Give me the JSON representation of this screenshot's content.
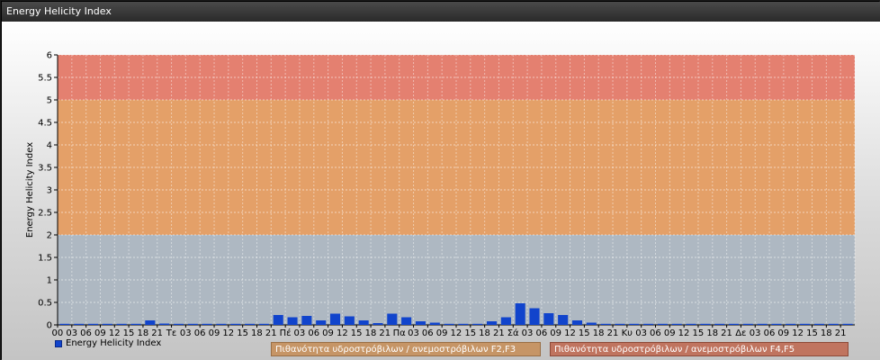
{
  "window": {
    "title": "Energy Helicity Index"
  },
  "colors": {
    "bar": "#1144cc",
    "band_low": "#aeb8c2",
    "band_mid": "#e4a068",
    "band_high": "#e48070"
  },
  "chart_data": {
    "type": "bar",
    "title": "",
    "xlabel": "",
    "ylabel": "Energy Helicity Index",
    "ylim": [
      0,
      6
    ],
    "yticks": [
      "0",
      "0.5",
      "1",
      "1.5",
      "2",
      "2.5",
      "3",
      "3.5",
      "4",
      "4.5",
      "5",
      "5.5",
      "6"
    ],
    "grid": true,
    "categories": [
      "00",
      "03",
      "06",
      "09",
      "12",
      "15",
      "18",
      "21",
      "Τε",
      "03",
      "06",
      "09",
      "12",
      "15",
      "18",
      "21",
      "Πέ",
      "03",
      "06",
      "09",
      "12",
      "15",
      "18",
      "21",
      "Πα",
      "03",
      "06",
      "09",
      "12",
      "15",
      "18",
      "21",
      "Σά",
      "03",
      "06",
      "09",
      "12",
      "15",
      "18",
      "21",
      "Κυ",
      "03",
      "06",
      "09",
      "12",
      "15",
      "18",
      "21",
      "Δε",
      "03",
      "06",
      "09",
      "12",
      "15",
      "18",
      "21"
    ],
    "series": [
      {
        "name": "Energy Helicity Index",
        "values": [
          0,
          0,
          0,
          0,
          0,
          0,
          0.1,
          0.03,
          0,
          0,
          0,
          0,
          0,
          0,
          0.02,
          0.22,
          0.17,
          0.2,
          0.1,
          0.25,
          0.19,
          0.1,
          0.04,
          0.25,
          0.17,
          0.08,
          0.05,
          0.02,
          0.02,
          0.02,
          0.08,
          0.17,
          0.48,
          0.37,
          0.26,
          0.22,
          0.1,
          0.05,
          0,
          0,
          0,
          0,
          0,
          0,
          0,
          0,
          0,
          0,
          0,
          0,
          0,
          0,
          0,
          0,
          0,
          0
        ]
      }
    ],
    "bands": [
      {
        "from": 0,
        "to": 2,
        "color_key": "band_low",
        "label": ""
      },
      {
        "from": 2,
        "to": 5,
        "color_key": "band_mid",
        "label": "Πιθανότητα υδροστρόβιλων / ανεμοστρόβιλων F2,F3"
      },
      {
        "from": 5,
        "to": 6,
        "color_key": "band_high",
        "label": "Πιθανότητα υδροστρόβιλων / ανεμοστρόβιλων F4,F5"
      }
    ],
    "legend": {
      "placement": "bottom-left",
      "label": "Energy Helicity Index"
    }
  }
}
